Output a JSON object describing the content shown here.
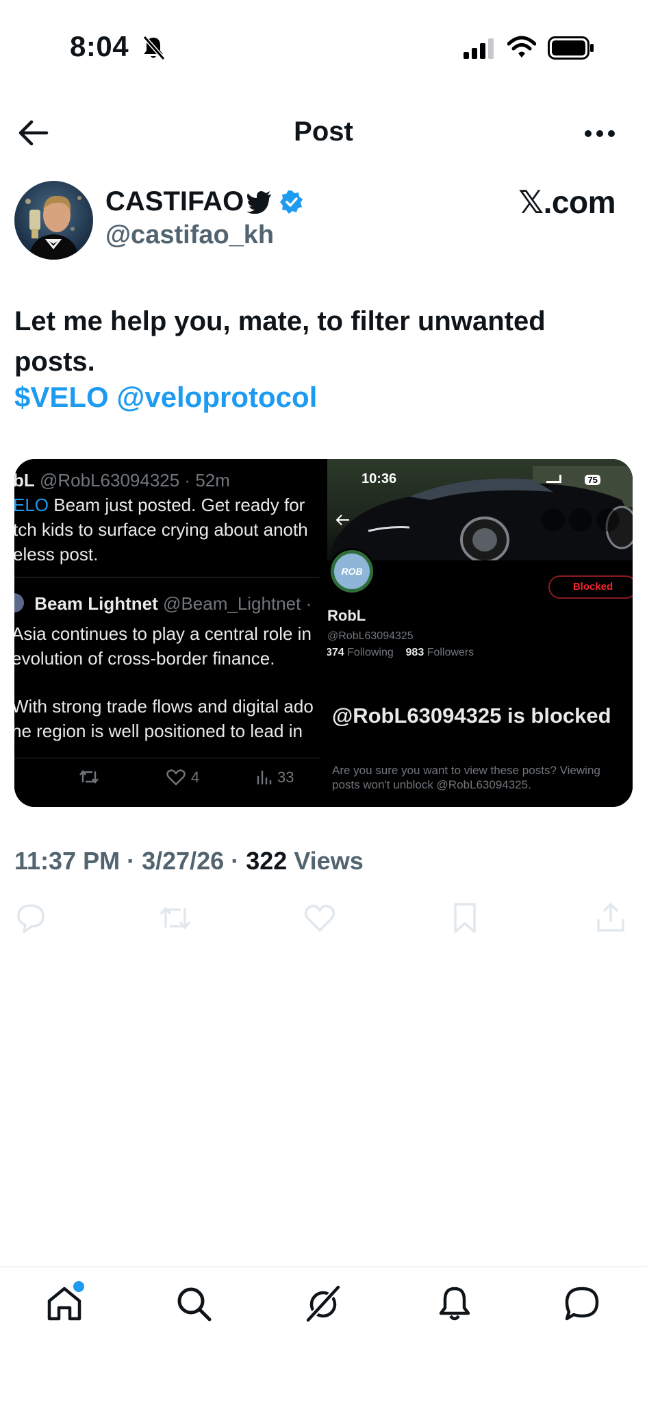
{
  "status_bar": {
    "time": "8:04"
  },
  "header": {
    "title": "Post"
  },
  "author": {
    "display_name": "CASTIFAO",
    "handle": "@castifao_kh",
    "brand": "𝕏.com"
  },
  "post": {
    "text": "Let me help you, mate, to filter unwanted posts.",
    "cashtag": "$VELO",
    "mention": "@veloprotocol"
  },
  "media_left": {
    "line1_name": "bL",
    "line1_meta": "@RobL63094325 · 52m",
    "line2_link": "ELO",
    "line2_text": " Beam just posted. Get ready for",
    "line3": "tch kids to surface crying about anoth",
    "line4": "eless post.",
    "quoted_name": "Beam Lightnet",
    "quoted_handle": "@Beam_Lightnet ·",
    "q_line1": "Asia continues to play a central role in",
    "q_line2": "evolution of cross-border finance.",
    "q_line3": "With strong trade flows and digital ado",
    "q_line4": "he region is well positioned to lead in",
    "likes": "4",
    "views": "33"
  },
  "media_right": {
    "time": "10:36",
    "battery": "75",
    "avatar_text": "ROB",
    "blocked_label": "Blocked",
    "name": "RobL",
    "handle": "@RobL63094325",
    "following_count": "374",
    "following_label": "Following",
    "followers_count": "983",
    "followers_label": "Followers",
    "blocked_title": "@RobL63094325 is blocked",
    "blocked_desc": "Are you sure you want to view these posts? Viewing posts won't unblock @RobL63094325."
  },
  "meta": {
    "time": "11:37 PM",
    "date": "3/27/26",
    "views_count": "322",
    "views_label": "Views"
  },
  "colors": {
    "accent": "#1d9bf0",
    "text": "#0f1419",
    "muted": "#536471",
    "danger": "#f4212e"
  }
}
